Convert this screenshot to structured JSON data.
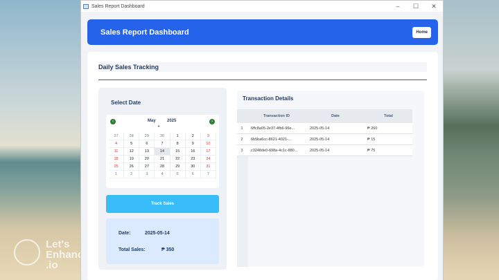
{
  "window": {
    "title": "Sales Report Dashboard",
    "controls": {
      "minimize": "–",
      "maximize": "☐",
      "close": "✕"
    }
  },
  "header": {
    "title": "Sales Report Dashboard",
    "home_label": "Home"
  },
  "section": {
    "title": "Daily Sales Tracking"
  },
  "left_panel": {
    "select_date_label": "Select Date",
    "calendar": {
      "month": "May",
      "year": "2025",
      "prev_icon": "‹",
      "next_icon": "›",
      "weeks": [
        [
          "27",
          "28",
          "29",
          "30",
          "1",
          "2",
          "3"
        ],
        [
          "4",
          "5",
          "6",
          "7",
          "8",
          "9",
          "10"
        ],
        [
          "11",
          "12",
          "13",
          "14",
          "15",
          "16",
          "17"
        ],
        [
          "18",
          "19",
          "20",
          "21",
          "22",
          "23",
          "24"
        ],
        [
          "25",
          "26",
          "27",
          "28",
          "29",
          "30",
          "31"
        ],
        [
          "1",
          "2",
          "3",
          "4",
          "5",
          "6",
          "7"
        ]
      ],
      "selected": "14"
    },
    "track_button": "Track Sales",
    "summary": {
      "date_label": "Date:",
      "date_value": "2025-05-14",
      "total_label": "Total Sales:",
      "total_value": "₱ 350"
    }
  },
  "right_panel": {
    "title": "Transaction Details",
    "columns": [
      "Transaction ID",
      "Date",
      "Total"
    ],
    "rows": [
      {
        "index": "1",
        "id": "6ffc8a05-2e37-4fb6-96e...",
        "date": "2025-05-14",
        "total": "₱ 260"
      },
      {
        "index": "2",
        "id": "6b5ba6cc-8621-4021-...",
        "date": "2025-05-14",
        "total": "₱ 15"
      },
      {
        "index": "3",
        "id": "c3248de0-698a-4c1c-880...",
        "date": "2025-05-14",
        "total": "₱ 75"
      }
    ]
  },
  "watermark": {
    "text": "Let's\nEnhance\n.io"
  },
  "colors": {
    "header_bg": "#2563eb",
    "track_button_bg": "#38bdf8",
    "summary_bg": "#dbeafe",
    "weekend": "#d32f2f",
    "nav_arrow": "#2e7d32"
  }
}
